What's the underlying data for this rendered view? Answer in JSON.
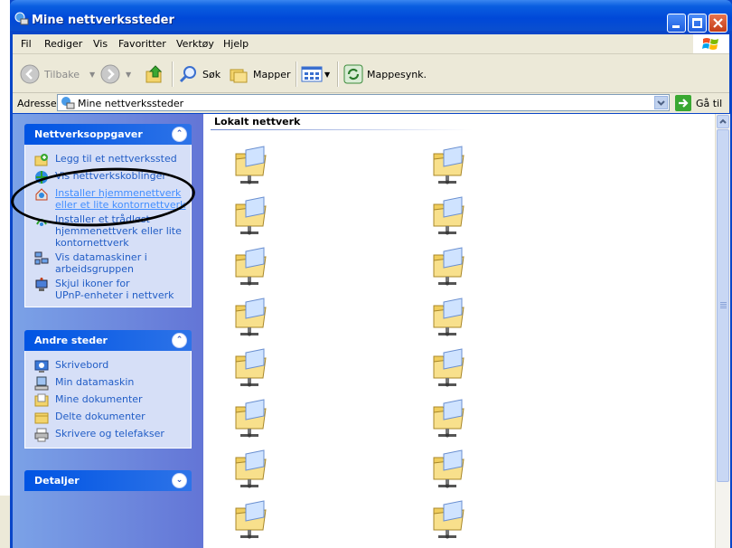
{
  "window": {
    "title": "Mine nettverkssteder"
  },
  "menu": [
    "Fil",
    "Rediger",
    "Vis",
    "Favoritter",
    "Verktøy",
    "Hjelp"
  ],
  "toolbar": {
    "back": "Tilbake",
    "search": "Søk",
    "folders": "Mapper",
    "sync": "Mappesynk."
  },
  "address": {
    "label": "Adresse",
    "value": "Mine nettverkssteder",
    "go": "Gå til"
  },
  "network_tasks": {
    "title": "Nettverksoppgaver",
    "items": [
      {
        "label": "Legg til et nettverkssted",
        "icon": "add-network-place-icon"
      },
      {
        "label": "Vis nettverkskoblinger",
        "icon": "network-connections-icon"
      },
      {
        "label": "Installer hjemmenettverk\neller et lite kontornettverk",
        "icon": "home-network-icon"
      },
      {
        "label": "Installer et trådløst\nhjemmenettverk eller lite\nkontornettverk",
        "icon": "wireless-network-icon"
      },
      {
        "label": "Vis datamaskiner i\narbeidsgruppen",
        "icon": "workgroup-icon"
      },
      {
        "label": "Skjul ikoner for\nUPnP-enheter i nettverk",
        "icon": "upnp-icon"
      }
    ]
  },
  "other_places": {
    "title": "Andre steder",
    "items": [
      {
        "label": "Skrivebord",
        "icon": "desktop-icon"
      },
      {
        "label": "Min datamaskin",
        "icon": "my-computer-icon"
      },
      {
        "label": "Mine dokumenter",
        "icon": "my-documents-icon"
      },
      {
        "label": "Delte dokumenter",
        "icon": "shared-documents-icon"
      },
      {
        "label": "Skrivere og telefakser",
        "icon": "printers-icon"
      }
    ]
  },
  "details": {
    "title": "Detaljer"
  },
  "main": {
    "group_title": "Lokalt nettverk",
    "shared_folder_count": 16
  },
  "colors": {
    "link": "#215dc6",
    "taskpane": "#6375d6",
    "title_bar": "#0054e3"
  }
}
